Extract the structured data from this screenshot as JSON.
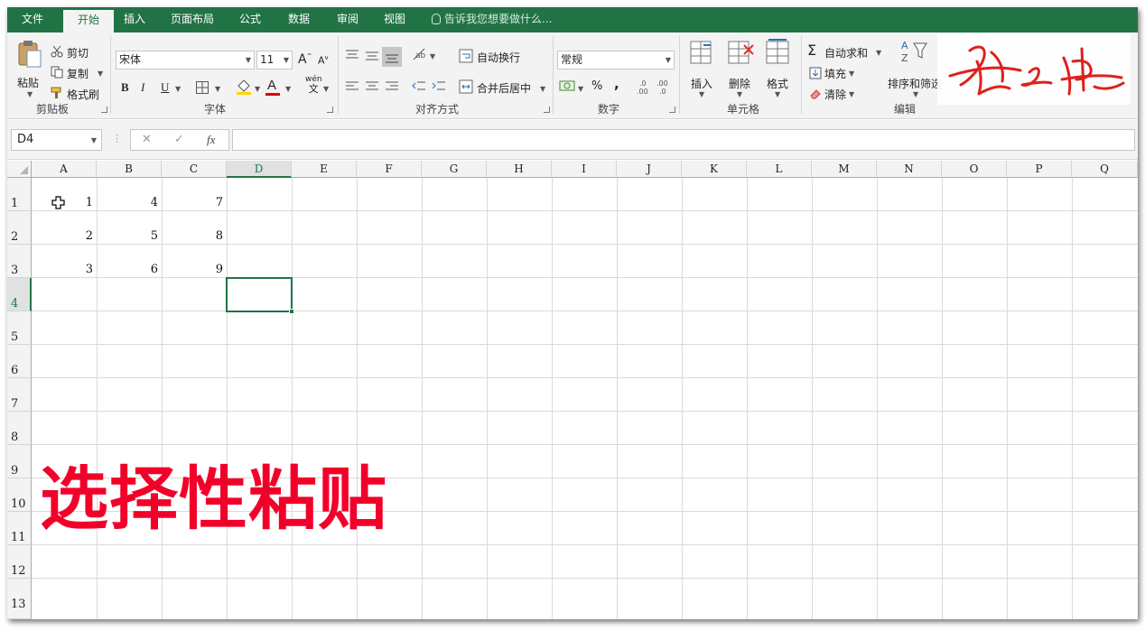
{
  "tabs": [
    {
      "label": "文件",
      "active": false
    },
    {
      "label": "开始",
      "active": true
    },
    {
      "label": "插入",
      "active": false
    },
    {
      "label": "页面布局",
      "active": false
    },
    {
      "label": "公式",
      "active": false
    },
    {
      "label": "数据",
      "active": false
    },
    {
      "label": "审阅",
      "active": false
    },
    {
      "label": "视图",
      "active": false
    }
  ],
  "tell_me": "告诉我您想要做什么...",
  "ribbon": {
    "clipboard": {
      "paste": "粘贴",
      "cut": "剪切",
      "copy": "复制",
      "format_painter": "格式刷",
      "group": "剪贴板"
    },
    "font": {
      "name": "宋体",
      "size": "11",
      "bold": "B",
      "italic": "I",
      "underline": "U",
      "font_color_glyph": "A",
      "phonetic": "wén",
      "phonetic_char": "文",
      "grow": "A",
      "shrink": "A",
      "group": "字体"
    },
    "alignment": {
      "wrap_text": "自动换行",
      "merge_center": "合并后居中",
      "group": "对齐方式"
    },
    "number": {
      "format": "常规",
      "percent": "%",
      "comma": ",",
      "group": "数字"
    },
    "cells": {
      "insert": "插入",
      "delete": "删除",
      "format": "格式",
      "group": "单元格"
    },
    "editing": {
      "autosum": "自动求和",
      "fill": "填充",
      "clear": "清除",
      "sort_filter": "排序和筛选",
      "group": "编辑"
    }
  },
  "formula_bar": {
    "name_box": "D4",
    "cancel": "✕",
    "enter": "✓",
    "fx": "fx",
    "content": ""
  },
  "sheet": {
    "columns": [
      "A",
      "B",
      "C",
      "D",
      "E",
      "F",
      "G",
      "H",
      "I",
      "J",
      "K",
      "L",
      "M",
      "N",
      "O",
      "P",
      "Q"
    ],
    "rows": [
      "1",
      "2",
      "3",
      "4",
      "5",
      "6",
      "7",
      "8",
      "9",
      "10",
      "11",
      "12",
      "13"
    ],
    "selected_cell": "D4",
    "cells": [
      [
        "1",
        "4",
        "7"
      ],
      [
        "2",
        "5",
        "8"
      ],
      [
        "3",
        "6",
        "9"
      ]
    ]
  },
  "overlay_title": "选择性粘贴",
  "colors": {
    "accent": "#217346",
    "overlay": "#f3002a",
    "signature": "#e0201c"
  }
}
